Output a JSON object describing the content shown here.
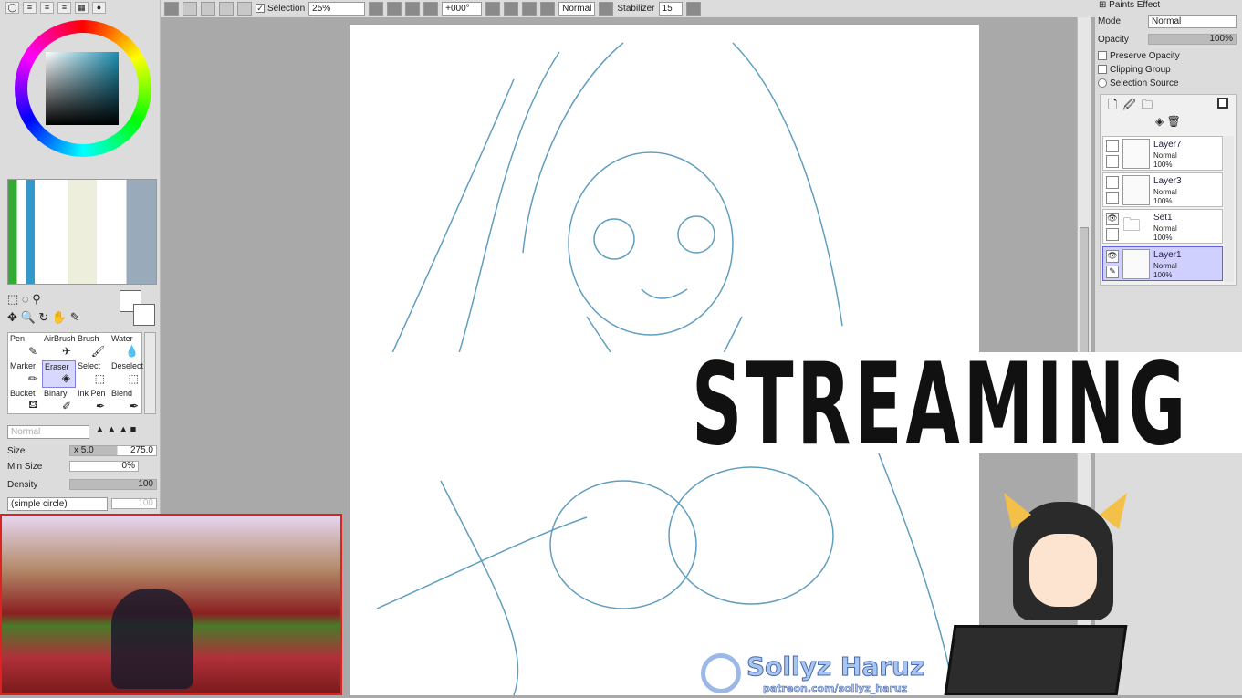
{
  "toolbar": {
    "selection_label": "Selection",
    "zoom": "25%",
    "rotation": "+000°",
    "blend_mode": "Normal",
    "stabilizer_label": "Stabilizer",
    "stabilizer_value": "15"
  },
  "tools": {
    "items": [
      {
        "label": "Pen",
        "icon": "pen-icon"
      },
      {
        "label": "AirBrush",
        "icon": "airbrush-icon"
      },
      {
        "label": "Brush",
        "icon": "brush-icon"
      },
      {
        "label": "Water",
        "icon": "water-icon"
      },
      {
        "label": "Marker",
        "icon": "marker-icon"
      },
      {
        "label": "Eraser",
        "icon": "eraser-icon"
      },
      {
        "label": "Select",
        "icon": "select-icon"
      },
      {
        "label": "Deselect",
        "icon": "deselect-icon"
      },
      {
        "label": "Bucket",
        "icon": "bucket-icon"
      },
      {
        "label": "Binary",
        "icon": "binary-icon"
      },
      {
        "label": "Ink Pen",
        "icon": "ink-pen-icon"
      },
      {
        "label": "Blend",
        "icon": "blend-icon"
      }
    ],
    "selected": "Eraser"
  },
  "brush": {
    "mode": "Normal",
    "size_label": "Size",
    "size_mult": "x 5.0",
    "size_value": "275.0",
    "min_size_label": "Min Size",
    "min_size_value": "0%",
    "density_label": "Density",
    "density_value": "100",
    "shape": "(simple circle)",
    "shape_value": "100"
  },
  "layer_panel": {
    "paints_effect": "Paints Effect",
    "mode_label": "Mode",
    "mode_value": "Normal",
    "opacity_label": "Opacity",
    "opacity_value": "100%",
    "preserve_opacity": "Preserve Opacity",
    "clipping_group": "Clipping Group",
    "selection_source": "Selection Source",
    "layers": [
      {
        "name": "Layer7",
        "mode": "Normal",
        "opacity": "100%",
        "visible": false
      },
      {
        "name": "Layer3",
        "mode": "Normal",
        "opacity": "100%",
        "visible": false
      },
      {
        "name": "Set1",
        "mode": "Normal",
        "opacity": "100%",
        "visible": true
      },
      {
        "name": "Layer1",
        "mode": "Normal",
        "opacity": "100%",
        "visible": true
      }
    ]
  },
  "overlay": {
    "banner": "STREAMING",
    "patreon_name": "Sollyz Haruz",
    "patreon_url": "patreon.com/sollyz_haruz"
  },
  "colors": {
    "sketch": "#3a86b0",
    "selected_layer": "#d0d0ff",
    "cam_border": "#dd2222"
  }
}
